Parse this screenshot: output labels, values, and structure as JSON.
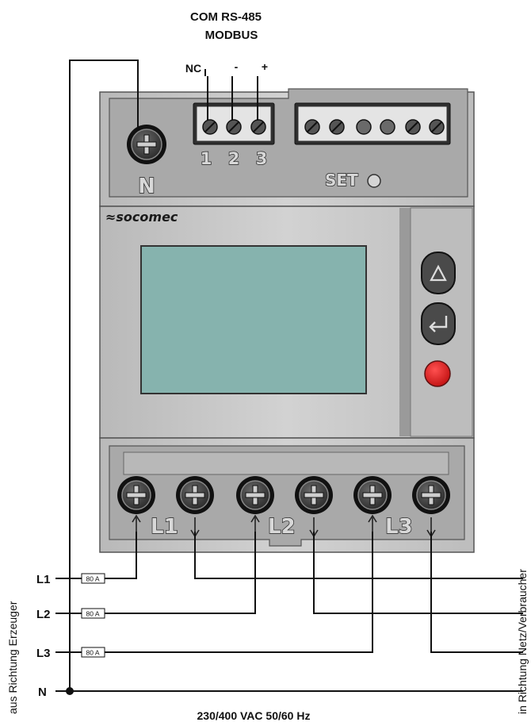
{
  "header": {
    "line1": "COM RS-485",
    "line2": "MODBUS"
  },
  "com_pins": {
    "nc": "NC",
    "minus": "-",
    "plus": "+"
  },
  "com_terminal_numbers": [
    "1",
    "2",
    "3"
  ],
  "neutral_terminal_label": "N",
  "set_label": "SET",
  "brand": "≈socomec",
  "phase_labels": [
    "L1",
    "L2",
    "L3"
  ],
  "lines": {
    "l1": "L1",
    "l2": "L2",
    "l3": "L3",
    "n": "N"
  },
  "fuses": [
    "80 A",
    "80 A",
    "80 A"
  ],
  "side_left": "aus Richtung Erzeuger",
  "side_right": "in Richtung Netz/Verbraucher",
  "footer": "230/400 VAC 50/60 Hz",
  "colors": {
    "housing": "#c7c7c7",
    "screen": "#86b3ae",
    "red_button": "#e02020",
    "dark_button": "#4a4a4a"
  },
  "icons": [
    "screw-terminal-icon",
    "up-arrow-button-icon",
    "enter-button-icon",
    "red-button-icon",
    "current-arrow-up-icon",
    "current-arrow-down-icon"
  ]
}
